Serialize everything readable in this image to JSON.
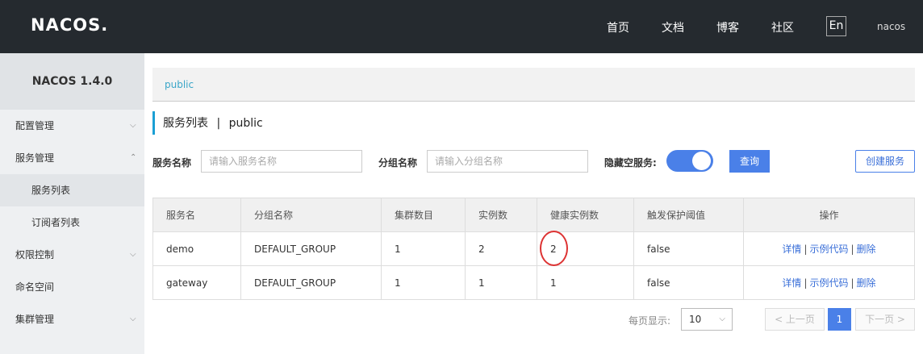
{
  "header": {
    "logo": "NACOS.",
    "nav": [
      "首页",
      "文档",
      "博客",
      "社区"
    ],
    "lang": "En",
    "user": "nacos"
  },
  "sidebar": {
    "title": "NACOS 1.4.0",
    "items": [
      {
        "label": "配置管理",
        "chevron": "down"
      },
      {
        "label": "服务管理",
        "chevron": "up"
      },
      {
        "label": "服务列表"
      },
      {
        "label": "订阅者列表"
      },
      {
        "label": "权限控制",
        "chevron": "down"
      },
      {
        "label": "命名空间"
      },
      {
        "label": "集群管理",
        "chevron": "down"
      }
    ]
  },
  "breadcrumb": "public",
  "page_title": "服务列表",
  "page_title_sep": "|",
  "page_namespace": "public",
  "filters": {
    "service_label": "服务名称",
    "service_placeholder": "请输入服务名称",
    "group_label": "分组名称",
    "group_placeholder": "请输入分组名称",
    "hide_empty_label": "隐藏空服务:",
    "query_button": "查询",
    "create_button": "创建服务"
  },
  "table": {
    "headers": [
      "服务名",
      "分组名称",
      "集群数目",
      "实例数",
      "健康实例数",
      "触发保护阈值",
      "操作"
    ],
    "rows": [
      {
        "name": "demo",
        "group": "DEFAULT_GROUP",
        "clusters": "1",
        "instances": "2",
        "healthy": "2",
        "threshold": "false"
      },
      {
        "name": "gateway",
        "group": "DEFAULT_GROUP",
        "clusters": "1",
        "instances": "1",
        "healthy": "1",
        "threshold": "false"
      }
    ],
    "actions": {
      "detail": "详情",
      "sample": "示例代码",
      "delete": "删除",
      "sep": "|"
    }
  },
  "pagination": {
    "per_page_label": "每页显示:",
    "per_page": "10",
    "prev": "< 上一页",
    "page": "1",
    "next": "下一页 >"
  },
  "colors": {
    "accent": "#4a80e8",
    "topbar": "#252a2f",
    "highlight": "#dd3333"
  }
}
